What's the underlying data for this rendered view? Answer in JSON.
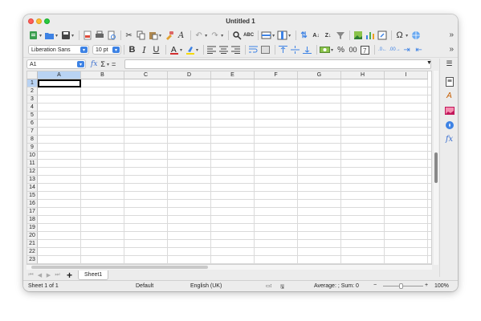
{
  "window": {
    "title": "Untitled 1"
  },
  "toolbar1": {
    "icons": [
      "new-document-icon",
      "open-folder-icon",
      "save-icon",
      "export-pdf-icon",
      "print-icon",
      "print-preview-icon",
      "cut-icon",
      "copy-icon",
      "paste-icon",
      "clone-formatting-icon",
      "clear-formatting-icon",
      "undo-icon",
      "redo-icon",
      "find-replace-icon",
      "spellcheck-icon",
      "row-icon",
      "column-icon",
      "sort-icon",
      "sort-ascending-icon",
      "sort-descending-icon",
      "autofilter-icon",
      "insert-image-icon",
      "insert-chart-icon",
      "pivot-table-icon",
      "special-character-icon",
      "hyperlink-icon"
    ],
    "more": "»"
  },
  "toolbar2": {
    "font_name": "Liberation Sans",
    "font_size": "10 pt",
    "bold": "B",
    "italic": "I",
    "underline": "U",
    "percent": "%",
    "decimal_00": "00",
    "more": "»"
  },
  "formula_bar": {
    "name_box": "A1",
    "fx": "fx",
    "sigma": "Σ",
    "equals": "=",
    "formula": ""
  },
  "grid": {
    "columns": [
      "A",
      "B",
      "C",
      "D",
      "E",
      "F",
      "G",
      "H",
      "I"
    ],
    "rows": [
      "1",
      "2",
      "3",
      "4",
      "5",
      "6",
      "7",
      "8",
      "9",
      "10",
      "11",
      "12",
      "13",
      "14",
      "15",
      "16",
      "17",
      "18",
      "19",
      "20",
      "21",
      "22",
      "23"
    ],
    "selected_cell": "A1"
  },
  "sheet_tabs": {
    "add": "+",
    "tabs": [
      "Sheet1"
    ]
  },
  "status_bar": {
    "sheet": "Sheet 1 of 1",
    "page_style": "Default",
    "language": "English (UK)",
    "summary": "Average: ; Sum: 0",
    "zoom_minus": "−",
    "zoom_plus": "+",
    "zoom": "100%"
  },
  "sidebar": {
    "icons": [
      "properties-icon",
      "styles-icon",
      "gallery-icon",
      "navigator-icon",
      "functions-icon"
    ]
  },
  "colors": {
    "accent": "#3d82e4",
    "selection": "#b9d3f3",
    "font_red": "#d32f2f",
    "highlight_yellow": "#f5d90a"
  }
}
